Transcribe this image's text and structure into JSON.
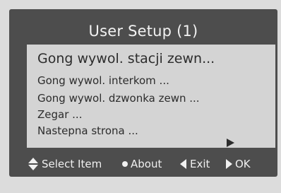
{
  "window": {
    "title": "User Setup  (1)"
  },
  "menu": {
    "items": [
      {
        "label": "Gong wywol. stacji zewn...",
        "selected": true
      },
      {
        "label": "Gong wywol. interkom ...",
        "selected": false
      },
      {
        "label": "Gong wywol. dzwonka zewn ...",
        "selected": false
      },
      {
        "label": "Zegar ...",
        "selected": false
      },
      {
        "label": "Nastepna strona ...",
        "selected": false
      }
    ],
    "next_icon": "right-triangle-icon"
  },
  "footer": {
    "select": {
      "icon": "up-down-arrows-icon",
      "label": "Select Item"
    },
    "about": {
      "icon": "dot-icon",
      "label": "About"
    },
    "exit": {
      "icon": "left-triangle-icon",
      "label": "Exit"
    },
    "ok": {
      "icon": "right-triangle-icon",
      "label": "OK"
    }
  },
  "colors": {
    "panel": "#4d4d4d",
    "menu_background": "#d4d4d4",
    "text_light": "#f0f0f0",
    "text_dark": "#2c2c2c"
  }
}
